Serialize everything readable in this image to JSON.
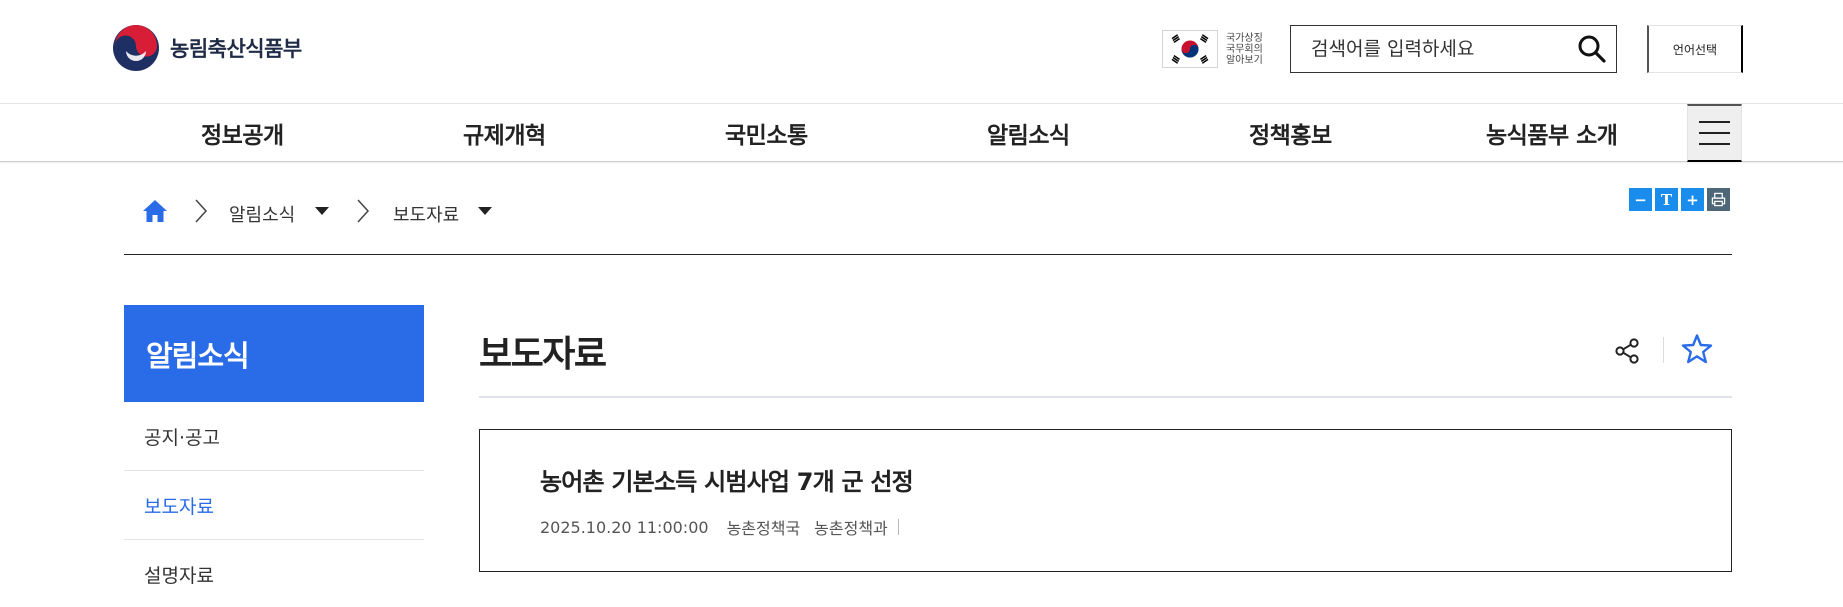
{
  "header": {
    "logo_text": "농림축산식품부",
    "flag_text": [
      "국가상징",
      "국무회의",
      "알아보기"
    ],
    "search_placeholder": "검색어를 입력하세요",
    "lang_label": "언어선택"
  },
  "gnb": {
    "items": [
      "정보공개",
      "규제개혁",
      "국민소통",
      "알림소식",
      "정책홍보",
      "농식품부 소개"
    ]
  },
  "breadcrumb": {
    "level1": "알림소식",
    "level2": "보도자료"
  },
  "tools": {
    "zoom_out": "−",
    "text": "T",
    "zoom_in": "+"
  },
  "lnb": {
    "title": "알림소식",
    "items": [
      "공지·공고",
      "보도자료",
      "설명자료"
    ],
    "active_index": 1
  },
  "content": {
    "title": "보도자료",
    "article": {
      "title": "농어촌 기본소득 시범사업 7개 군 선정",
      "date": "2025.10.20 11:00:00",
      "bureau": "농촌정책국",
      "division": "농촌정책과"
    }
  },
  "colors": {
    "accent_blue": "#2a6be8",
    "tool_blue": "#1a8ceb",
    "tool_gray": "#4d6678",
    "home_icon": "#2a6be8"
  },
  "icons": {
    "logo": "taegeuk-logo-icon",
    "flag": "taegeukgi-flag-icon",
    "search": "search-icon",
    "menu": "hamburger-menu-icon",
    "home": "home-icon",
    "share": "share-icon",
    "favorite": "star-icon",
    "print": "print-icon"
  }
}
